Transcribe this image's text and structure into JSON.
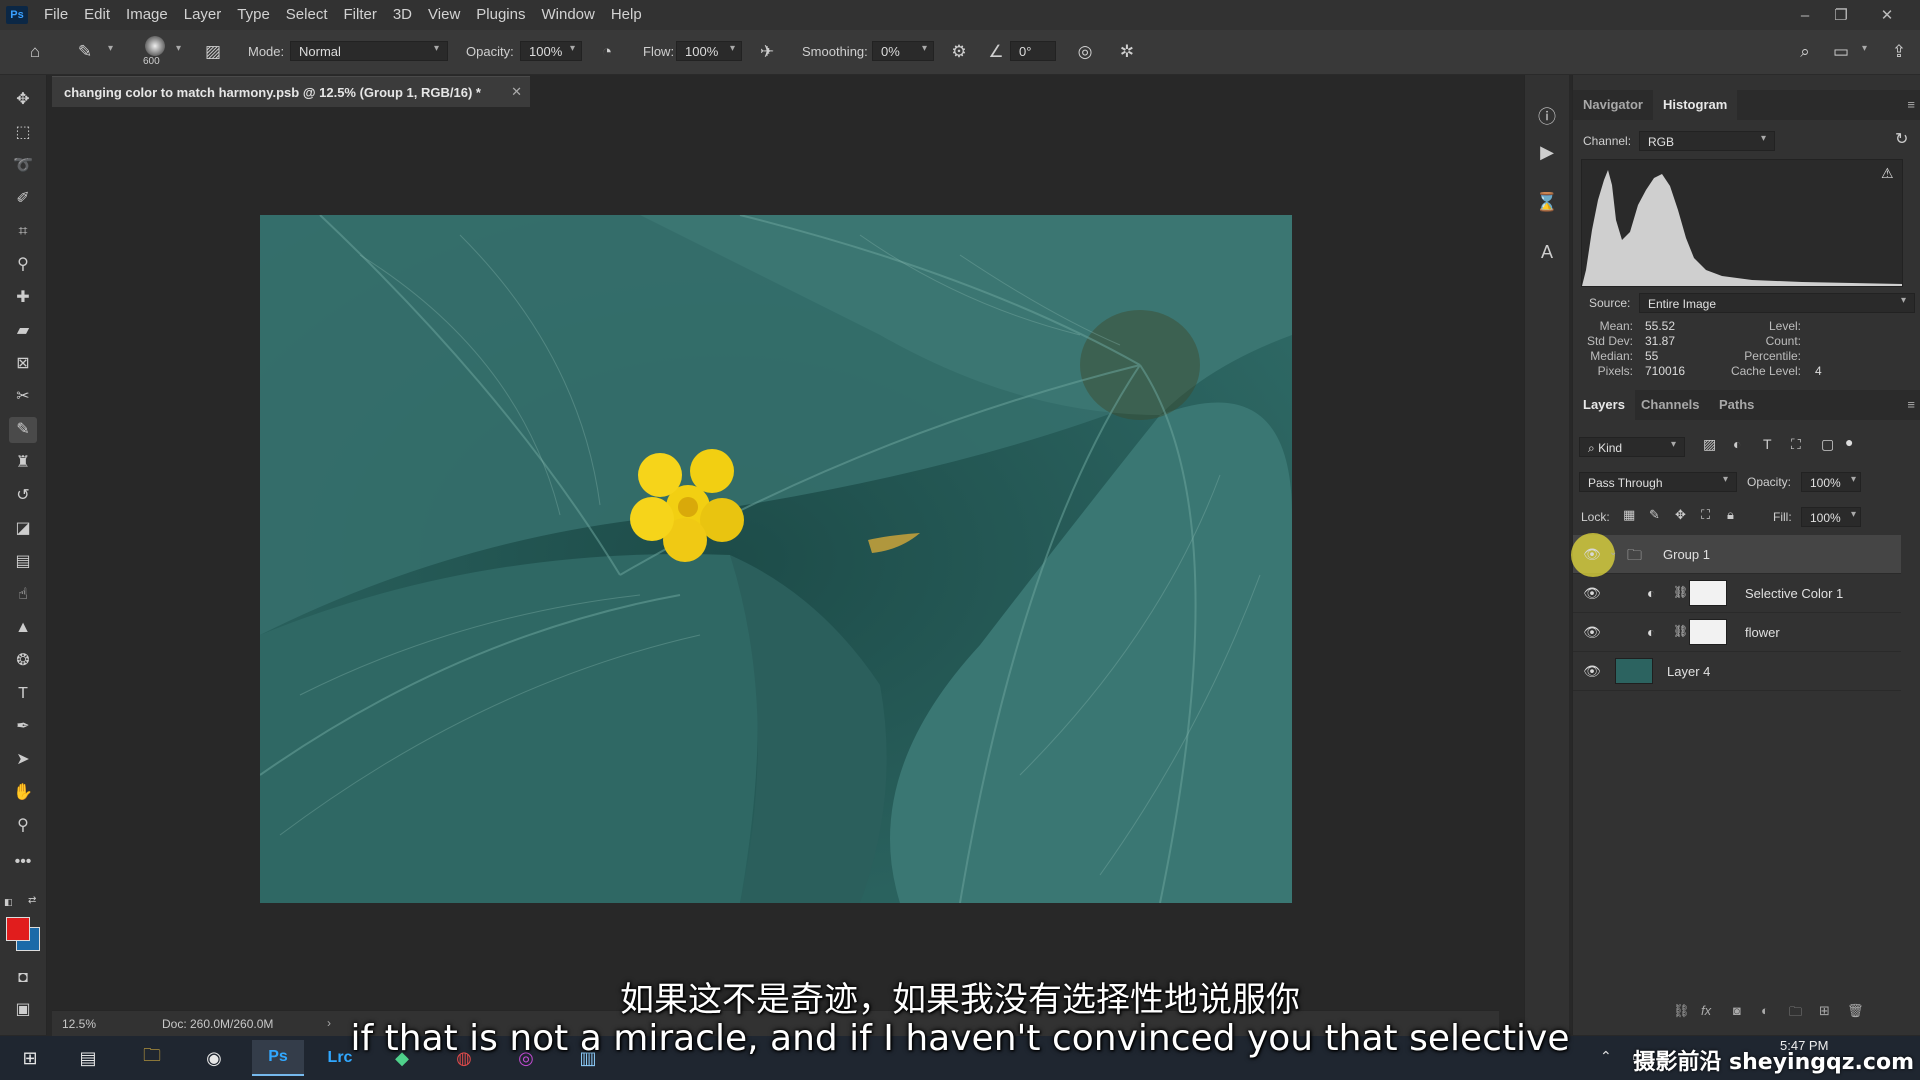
{
  "app": {
    "logo": "Ps"
  },
  "menu": [
    "File",
    "Edit",
    "Image",
    "Layer",
    "Type",
    "Select",
    "Filter",
    "3D",
    "View",
    "Plugins",
    "Window",
    "Help"
  ],
  "window_controls": {
    "minimize": "–",
    "restore": "❐",
    "close": "✕"
  },
  "options_bar": {
    "brush_size": "600",
    "mode_label": "Mode:",
    "mode_value": "Normal",
    "opacity_label": "Opacity:",
    "opacity_value": "100%",
    "flow_label": "Flow:",
    "flow_value": "100%",
    "smoothing_label": "Smoothing:",
    "smoothing_value": "0%",
    "angle_value": "0°"
  },
  "document": {
    "tab_title": "changing color to match harmony.psb @ 12.5% (Group 1, RGB/16) *",
    "zoom": "12.5%",
    "doc_size": "Doc: 260.0M/260.0M"
  },
  "colors": {
    "foreground": "#e11d1d",
    "background": "#1b6aa8",
    "accent": "#76b9ed"
  },
  "histogram_panel": {
    "tabs": [
      "Navigator",
      "Histogram"
    ],
    "active_tab": "Histogram",
    "channel_label": "Channel:",
    "channel_value": "RGB",
    "source_label": "Source:",
    "source_value": "Entire Image",
    "stats": {
      "mean_label": "Mean:",
      "mean": "55.52",
      "stddev_label": "Std Dev:",
      "stddev": "31.87",
      "median_label": "Median:",
      "median": "55",
      "pixels_label": "Pixels:",
      "pixels": "710016",
      "level_label": "Level:",
      "count_label": "Count:",
      "percentile_label": "Percentile:",
      "cache_label": "Cache Level:",
      "cache": "4"
    }
  },
  "layers_panel": {
    "tabs": [
      "Layers",
      "Channels",
      "Paths"
    ],
    "active_tab": "Layers",
    "filter_value": "Kind",
    "blend_value": "Pass Through",
    "opacity_label": "Opacity:",
    "opacity_value": "100%",
    "lock_label": "Lock:",
    "fill_label": "Fill:",
    "fill_value": "100%",
    "layers": [
      {
        "name": "Group 1"
      },
      {
        "name": "Selective Color 1"
      },
      {
        "name": "flower"
      },
      {
        "name": "Layer 4"
      }
    ]
  },
  "taskbar": {
    "clock": "5:47 PM",
    "lrc": "Lrc",
    "ps": "Ps"
  },
  "subtitles": {
    "chinese": "如果这不是奇迹，如果我没有选择性地说服你",
    "english": "if that is not a miracle, and if I haven't convinced you that selective"
  },
  "watermark": "摄影前沿 sheyingqz.com"
}
